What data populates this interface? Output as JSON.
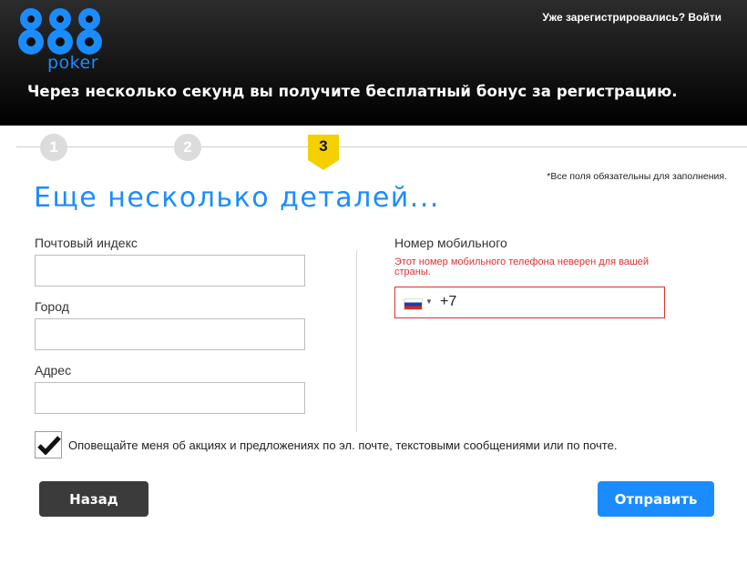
{
  "header": {
    "logo_digits": "888",
    "logo_word": "poker",
    "login_link": "Уже зарегистрировались? Войти",
    "tagline": "Через несколько секунд вы получите бесплатный бонус за регистрацию."
  },
  "steps": {
    "items": [
      {
        "number": "1",
        "state": "done"
      },
      {
        "number": "2",
        "state": "done"
      },
      {
        "number": "3",
        "state": "current"
      }
    ],
    "current": 3
  },
  "form": {
    "required_note": "*Все поля обязательны для заполнения.",
    "title": "Еще несколько деталей...",
    "postal": {
      "label": "Почтовый индекс",
      "value": ""
    },
    "city": {
      "label": "Город",
      "value": ""
    },
    "address": {
      "label": "Адрес",
      "value": ""
    },
    "phone": {
      "label": "Номер мобильного",
      "error": "Этот номер мобильного телефона неверен для вашей страны.",
      "country_icon": "flag-russia-icon",
      "code": "+7",
      "value": ""
    },
    "opt_in": {
      "checked": true,
      "label": "Оповещайте меня об акциях и предложениях по эл. почте, текстовыми сообщениями или по почте."
    },
    "back_button": "Назад",
    "submit_button": "Отправить"
  },
  "colors": {
    "brand_blue": "#1a8cff",
    "step_active": "#f5d000",
    "error_red": "#e03030",
    "back_button": "#3b3b3b"
  }
}
